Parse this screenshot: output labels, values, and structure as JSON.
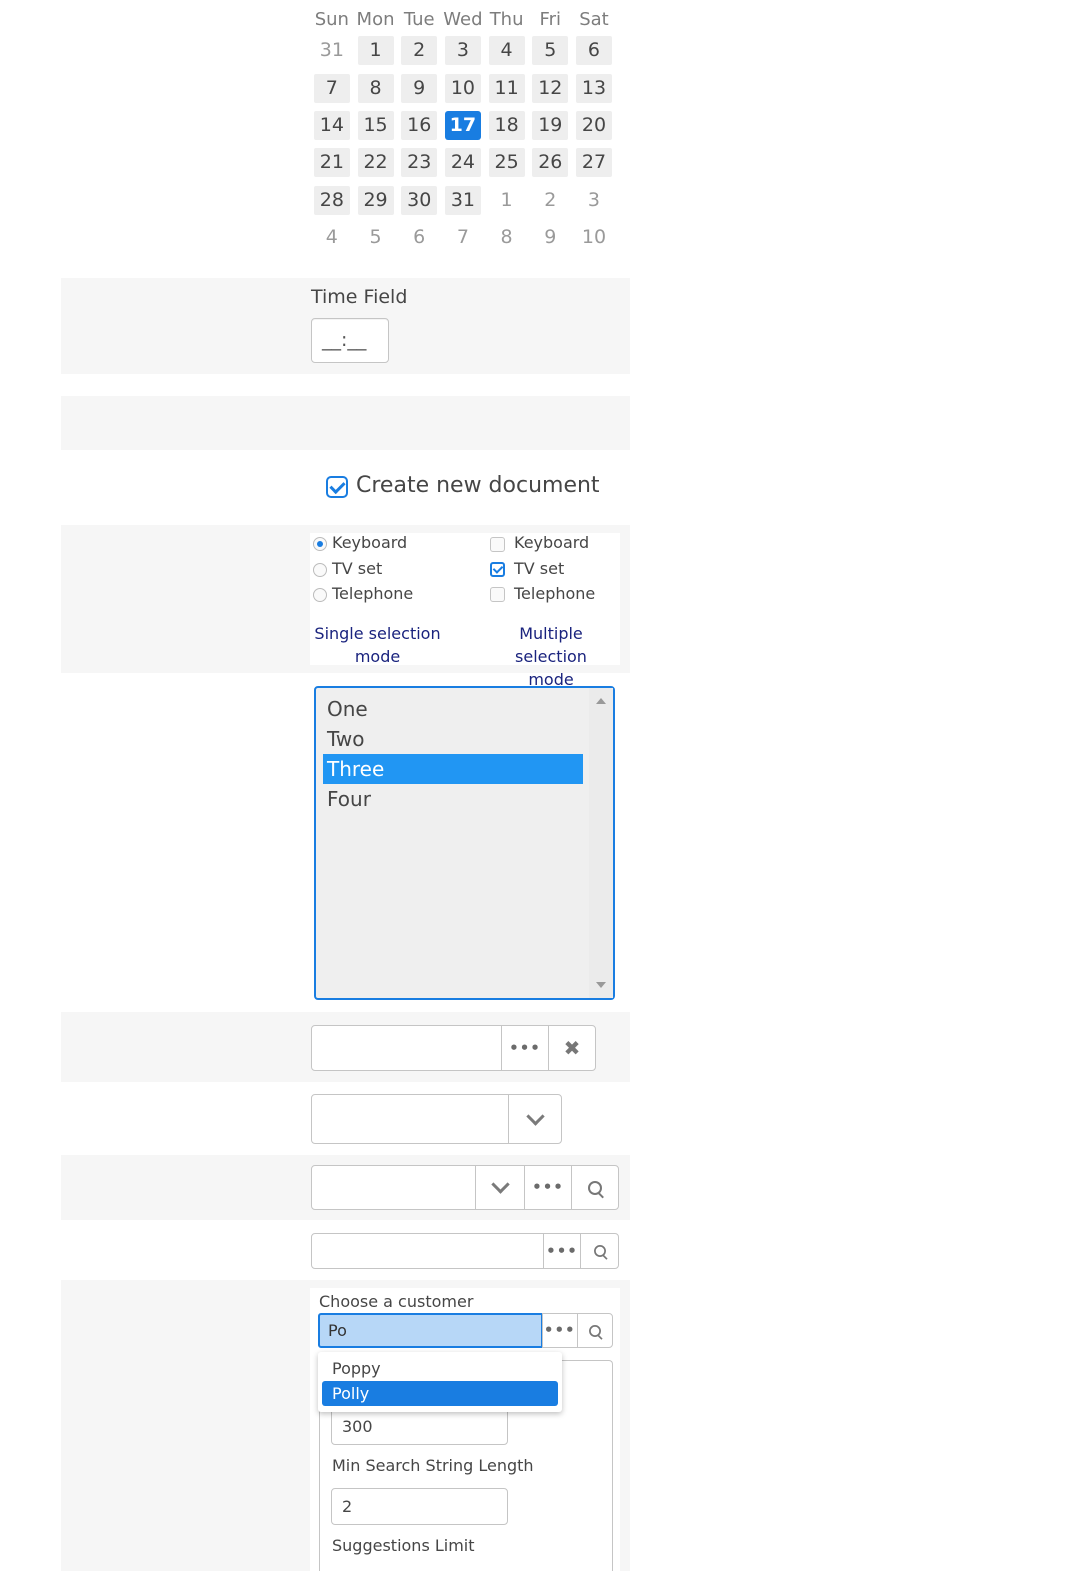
{
  "calendar": {
    "weekdays": [
      "Sun",
      "Mon",
      "Tue",
      "Wed",
      "Thu",
      "Fri",
      "Sat"
    ],
    "weeks": [
      [
        "31",
        "1",
        "2",
        "3",
        "4",
        "5",
        "6"
      ],
      [
        "7",
        "8",
        "9",
        "10",
        "11",
        "12",
        "13"
      ],
      [
        "14",
        "15",
        "16",
        "17",
        "18",
        "19",
        "20"
      ],
      [
        "21",
        "22",
        "23",
        "24",
        "25",
        "26",
        "27"
      ],
      [
        "28",
        "29",
        "30",
        "31",
        "1",
        "2",
        "3"
      ],
      [
        "4",
        "5",
        "6",
        "7",
        "8",
        "9",
        "10"
      ]
    ],
    "selected": "17",
    "accent_color": "#197de1"
  },
  "time_field": {
    "label": "Time Field",
    "value": "__:__"
  },
  "create_doc": {
    "label": "Create new document",
    "checked": true
  },
  "option_groups": {
    "single": {
      "items": [
        "Keyboard",
        "TV set",
        "Telephone"
      ],
      "selected": "Keyboard",
      "caption_line1": "Single selection",
      "caption_line2": "mode"
    },
    "multiple": {
      "items": [
        "Keyboard",
        "TV set",
        "Telephone"
      ],
      "checked": [
        "TV set"
      ],
      "caption_line1": "Multiple selection",
      "caption_line2": "mode"
    }
  },
  "listbox": {
    "items": [
      "One",
      "Two",
      "Three",
      "Four"
    ],
    "selected": "Three"
  },
  "customer_lookup": {
    "label": "Choose a customer",
    "value": "Po",
    "suggestions": [
      "Poppy",
      "Polly"
    ],
    "selected": "Polly",
    "fields": [
      {
        "value": "300"
      },
      {
        "label": "Min Search String Length",
        "value": "2"
      },
      {
        "label": "Suggestions Limit"
      }
    ]
  },
  "icons": {
    "picker": "ellipsis-icon",
    "clear": "close-icon",
    "dropdown": "chevron-down-icon",
    "lookup": "search-icon"
  }
}
